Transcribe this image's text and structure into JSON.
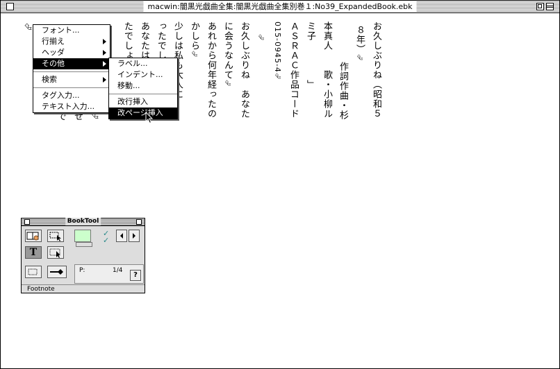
{
  "window": {
    "title": "macwin:闇黒光戯曲全集:闇黒光戯曲全集別巻１:No39_ExpandedBook.ebk"
  },
  "document": {
    "columns": [
      "お久しぶりね（昭和５",
      "８年）",
      "作詞作曲・杉",
      "本真人　　歌・小柳ル",
      "ミ子　　　　」",
      "ＡＳＲＡＣ作品コード",
      "015-0945-4",
      "",
      "お久しぶりね　あなた",
      "に会うなんて",
      "あれから何年経ったの",
      "かしら",
      "少しは私も大人に",
      "ったでしょう",
      "あなたは",
      "たでしょう"
    ],
    "return_mark": "⮰",
    "hidden_fragments": [
      "で",
      "せ",
      "⮰"
    ]
  },
  "context_menu": {
    "items": [
      {
        "label": "フォント...",
        "submenu": true
      },
      {
        "label": "行揃え",
        "submenu": true
      },
      {
        "label": "ヘッダ",
        "submenu": true
      },
      {
        "label": "その他",
        "submenu": true
      },
      {
        "label": "検索",
        "submenu": true
      },
      {
        "label": "タグ入力...",
        "submenu": false
      },
      {
        "label": "テキスト入力...",
        "submenu": false
      }
    ],
    "highlighted": "その他"
  },
  "submenu": {
    "items": [
      {
        "label": "ラベル..."
      },
      {
        "label": "インデント..."
      },
      {
        "label": "移動..."
      },
      {
        "label": "改行挿入"
      },
      {
        "label": "改ページ挿入"
      }
    ],
    "highlighted": "改ページ挿入"
  },
  "booktool": {
    "title": "BookTool",
    "page_label": "P:",
    "page_value": "1/4",
    "help_label": "?",
    "status": "Footnote",
    "text_tool_label": "T"
  },
  "colors": {
    "highlight_bg": "#000000",
    "highlight_fg": "#ffffff",
    "color_swatch": "#ccffcc",
    "check_color": "#2a8a8a"
  }
}
